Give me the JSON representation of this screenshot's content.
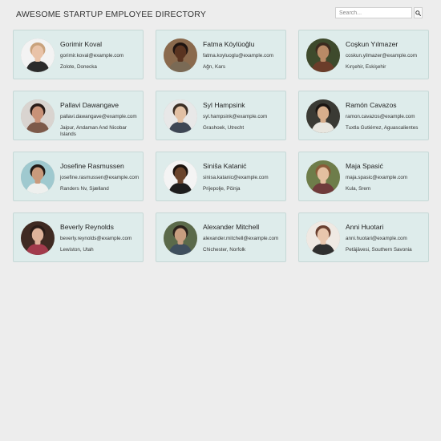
{
  "header": {
    "title": "AWESOME STARTUP EMPLOYEE DIRECTORY",
    "search": {
      "placeholder": "Search...",
      "value": "",
      "button_icon": "magnifier-icon"
    }
  },
  "employees": [
    {
      "name": "Gorimir Koval",
      "email": "gorimir.koval@example.com",
      "location": "Zolote, Donecka",
      "avatar": {
        "bg": "#f3f3f3",
        "skin": "#e9c3a8",
        "hair": "#c9a27c",
        "shirt": "#2b2b2b"
      }
    },
    {
      "name": "Fatma Köylüoğlu",
      "email": "fatma.koyluoglu@example.com",
      "location": "Ağrı, Kars",
      "avatar": {
        "bg": "#8a6a4d",
        "skin": "#5a3420",
        "hair": "#1e1410",
        "shirt": "#7a6a55"
      }
    },
    {
      "name": "Coşkun Yılmazer",
      "email": "coskun.yilmazer@example.com",
      "location": "Kırşehir, Eskişehir",
      "avatar": {
        "bg": "#3e4a2c",
        "skin": "#b98a66",
        "hair": "#3b2a1e",
        "shirt": "#6b3d2a"
      }
    },
    {
      "name": "Pallavi Dawangave",
      "email": "pallavi.dawangave@example.com",
      "location": "Jaipur, Andaman And Nicobar Islands",
      "avatar": {
        "bg": "#d9d4d0",
        "skin": "#c99278",
        "hair": "#2a1c18",
        "shirt": "#7d5a4a"
      }
    },
    {
      "name": "Syl Hampsink",
      "email": "syl.hampsink@example.com",
      "location": "Grashoek, Utrecht",
      "avatar": {
        "bg": "#e8e8e8",
        "skin": "#e2c0a4",
        "hair": "#3c2e24",
        "shirt": "#3e4654"
      }
    },
    {
      "name": "Ramón Cavazos",
      "email": "ramon.cavazos@example.com",
      "location": "Tuxtla Gutiérrez, Aguascalientes",
      "avatar": {
        "bg": "#3a3a34",
        "skin": "#d7ae8c",
        "hair": "#1b1512",
        "shirt": "#e8e6df"
      }
    },
    {
      "name": "Josefine Rasmussen",
      "email": "josefine.rasmussen@example.com",
      "location": "Randers Nv, Sjælland",
      "avatar": {
        "bg": "#9fc9cf",
        "skin": "#c99a7c",
        "hair": "#221a16",
        "shirt": "#eef0ee"
      }
    },
    {
      "name": "Siniša Katanić",
      "email": "sinisa.katanic@example.com",
      "location": "Prijepolje, Pčinja",
      "avatar": {
        "bg": "#f4f4f4",
        "skin": "#6a442c",
        "hair": "#1c130e",
        "shirt": "#1d1d1d"
      }
    },
    {
      "name": "Maja Spasić",
      "email": "maja.spasic@example.com",
      "location": "Kula, Srem",
      "avatar": {
        "bg": "#6e7d4a",
        "skin": "#e4bfa0",
        "hair": "#8a5a38",
        "shirt": "#6f3b3b"
      }
    },
    {
      "name": "Beverly Reynolds",
      "email": "beverly.reynolds@example.com",
      "location": "Lewiston, Utah",
      "avatar": {
        "bg": "#3f2a22",
        "skin": "#ddb29a",
        "hair": "#2a1c17",
        "shirt": "#a23b4c"
      }
    },
    {
      "name": "Alexander Mitchell",
      "email": "alexander.mitchell@example.com",
      "location": "Chichester, Norfolk",
      "avatar": {
        "bg": "#5b6a4a",
        "skin": "#c89e80",
        "hair": "#2a211b",
        "shirt": "#3f4f5e"
      }
    },
    {
      "name": "Anni Huotari",
      "email": "anni.huotari@example.com",
      "location": "Petäjävesi, Southern Savonia",
      "avatar": {
        "bg": "#efe9e3",
        "skin": "#e8c6ad",
        "hair": "#6a4030",
        "shirt": "#2f2f2f"
      }
    }
  ]
}
